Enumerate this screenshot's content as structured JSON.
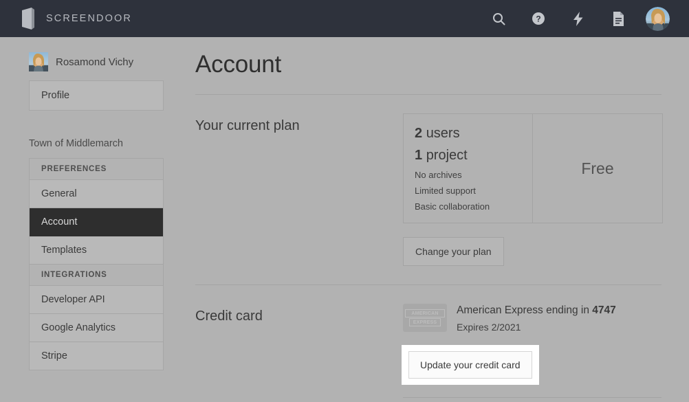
{
  "topnav": {
    "brand": "SCREENDOOR",
    "logo_icon": "door-icon",
    "icons": [
      {
        "name": "search-icon",
        "label": "Search"
      },
      {
        "name": "help-icon",
        "label": "Help"
      },
      {
        "name": "activity-bolt-icon",
        "label": "Activity"
      },
      {
        "name": "document-icon",
        "label": "Documents"
      }
    ],
    "avatar_alt": "Rosamond Vichy"
  },
  "sidebar": {
    "user_name": "Rosamond Vichy",
    "profile_label": "Profile",
    "org_name": "Town of Middlemarch",
    "sections": [
      {
        "header": "PREFERENCES",
        "items": [
          {
            "label": "General",
            "active": false
          },
          {
            "label": "Account",
            "active": true
          },
          {
            "label": "Templates",
            "active": false
          }
        ]
      },
      {
        "header": "INTEGRATIONS",
        "items": [
          {
            "label": "Developer API",
            "active": false
          },
          {
            "label": "Google Analytics",
            "active": false
          },
          {
            "label": "Stripe",
            "active": false
          }
        ]
      }
    ]
  },
  "main": {
    "page_title": "Account",
    "plan_section": {
      "label": "Your current plan",
      "users_count": "2",
      "users_word": "users",
      "projects_count": "1",
      "projects_word": "project",
      "features": [
        "No archives",
        "Limited support",
        "Basic collaboration"
      ],
      "plan_name": "Free",
      "change_plan_label": "Change your plan"
    },
    "credit_card_section": {
      "label": "Credit card",
      "brand_logo_line1": "AMERICAN",
      "brand_logo_line2": "EXPRESS",
      "card_description_prefix": "American Express ending in ",
      "card_last4": "4747",
      "expires": "Expires 2/2021",
      "update_label": "Update your credit card"
    }
  },
  "colors": {
    "topnav_bg": "#2e323c",
    "page_bg": "#b2b2b2",
    "panel_bg": "#b9b9b9",
    "active_item_bg": "#2e2e2e",
    "border": "#a3a3a3",
    "spotlight": "#ffffff"
  }
}
